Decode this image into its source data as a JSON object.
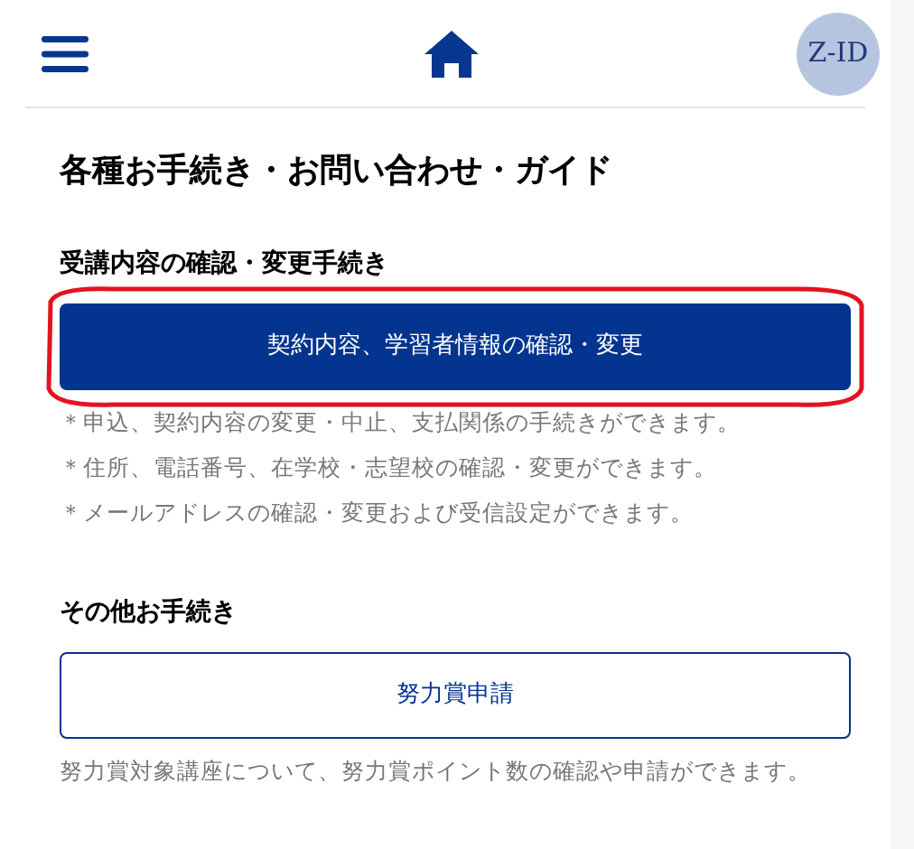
{
  "header": {
    "avatar": "Z-ID"
  },
  "title": "各種お手続き・お問い合わせ・ガイド",
  "sections": [
    {
      "heading": "受講内容の確認・変更手続き",
      "button": {
        "label": "契約内容、学習者情報の確認・変更",
        "kind": "filled",
        "circled": true
      },
      "notes": [
        "＊申込、契約内容の変更・中止、支払関係の手続きができます。",
        "＊住所、電話番号、在学校・志望校の確認・変更ができます。",
        "＊メールアドレスの確認・変更および受信設定ができます。"
      ]
    },
    {
      "heading": "その他お手続き",
      "button": {
        "label": "努力賞申請",
        "kind": "outline",
        "circled": false
      },
      "notes": [
        "努力賞対象講座について、努力賞ポイント数の確認や申請ができます。"
      ]
    }
  ]
}
